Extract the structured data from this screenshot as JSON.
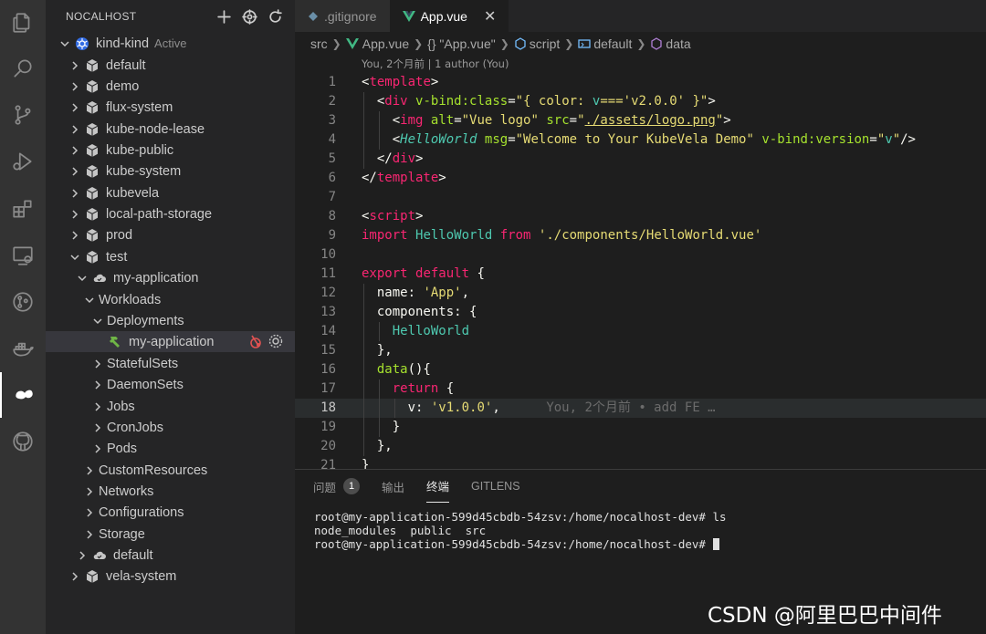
{
  "activity_bar": {
    "items": [
      {
        "name": "explorer-icon"
      },
      {
        "name": "search-icon"
      },
      {
        "name": "source-control-icon"
      },
      {
        "name": "run-debug-icon"
      },
      {
        "name": "extensions-icon"
      },
      {
        "name": "remote-explorer-icon"
      },
      {
        "name": "git-graph-icon"
      },
      {
        "name": "docker-icon"
      },
      {
        "name": "nocalhost-icon",
        "active": true
      },
      {
        "name": "github-icon"
      }
    ]
  },
  "sidebar": {
    "title": "NOCALHOST",
    "header_icons": [
      "plus-icon",
      "target-icon",
      "refresh-icon"
    ],
    "cluster": {
      "name": "kind-kind",
      "status": "Active"
    },
    "tree": [
      {
        "label": "default"
      },
      {
        "label": "demo"
      },
      {
        "label": "flux-system"
      },
      {
        "label": "kube-node-lease"
      },
      {
        "label": "kube-public"
      },
      {
        "label": "kube-system"
      },
      {
        "label": "kubevela"
      },
      {
        "label": "local-path-storage"
      },
      {
        "label": "prod"
      },
      {
        "label": "test"
      },
      {
        "label": "my-application"
      },
      {
        "label": "Workloads"
      },
      {
        "label": "Deployments"
      },
      {
        "label": "my-application"
      },
      {
        "label": "StatefulSets"
      },
      {
        "label": "DaemonSets"
      },
      {
        "label": "Jobs"
      },
      {
        "label": "CronJobs"
      },
      {
        "label": "Pods"
      },
      {
        "label": "CustomResources"
      },
      {
        "label": "Networks"
      },
      {
        "label": "Configurations"
      },
      {
        "label": "Storage"
      },
      {
        "label": "default"
      },
      {
        "label": "vela-system"
      }
    ]
  },
  "editor": {
    "tabs": [
      {
        "label": ".gitignore",
        "active": false
      },
      {
        "label": "App.vue",
        "active": true,
        "close": "✕"
      }
    ],
    "breadcrumb": [
      "src",
      "App.vue",
      "{} \"App.vue\"",
      "script",
      "default",
      "data"
    ],
    "blame_header": "You, 2个月前 | 1 author (You)",
    "line_numbers": [
      "1",
      "2",
      "3",
      "4",
      "5",
      "6",
      "7",
      "8",
      "9",
      "10",
      "11",
      "12",
      "13",
      "14",
      "15",
      "16",
      "17",
      "18",
      "19",
      "20",
      "21"
    ],
    "current_line": 18,
    "blame_inline": "You, 2个月前 • add FE …"
  },
  "panel": {
    "tabs": [
      {
        "label": "问题",
        "badge": "1"
      },
      {
        "label": "输出"
      },
      {
        "label": "终端",
        "active": true
      },
      {
        "label": "GITLENS"
      }
    ],
    "terminal_lines": [
      "root@my-application-599d45cbdb-54zsv:/home/nocalhost-dev# ls",
      "node_modules  public  src",
      "root@my-application-599d45cbdb-54zsv:/home/nocalhost-dev# "
    ]
  },
  "watermark": "CSDN @阿里巴巴中间件"
}
